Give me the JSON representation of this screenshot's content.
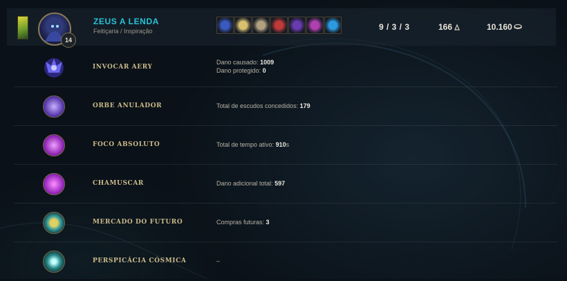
{
  "player": {
    "name": "ZEUS A LENDA",
    "rune_trees": "Feitiçaria / Inspiração",
    "level": "14",
    "kda": "9 / 3 / 3",
    "cs": "166",
    "gold": "10.160"
  },
  "items": [
    {
      "icon": "item-1-icon",
      "color": "#3a5ac0"
    },
    {
      "icon": "item-2-icon",
      "color": "#d8c070"
    },
    {
      "icon": "item-3-icon",
      "color": "#b0a080"
    },
    {
      "icon": "item-4-icon",
      "color": "#c03a3a"
    },
    {
      "icon": "item-5-icon",
      "color": "#6a3ab0"
    },
    {
      "icon": "item-6-icon",
      "color": "#b040b0"
    },
    {
      "icon": "item-7-icon",
      "color": "#2c9ae0"
    }
  ],
  "runes": [
    {
      "name": "INVOCAR AERY",
      "stats": [
        {
          "label": "Dano causado:",
          "value": "1009",
          "suffix": ""
        },
        {
          "label": "Dano protegido:",
          "value": "0",
          "suffix": ""
        }
      ],
      "color": "#5a5ae0"
    },
    {
      "name": "ORBE ANULADOR",
      "stats": [
        {
          "label": "Total de escudos concedidos:",
          "value": "179",
          "suffix": ""
        }
      ],
      "color": "#8a6ae0"
    },
    {
      "name": "FOCO ABSOLUTO",
      "stats": [
        {
          "label": "Total de tempo ativo:",
          "value": "910",
          "suffix": "s"
        }
      ],
      "color": "#b040c8"
    },
    {
      "name": "CHAMUSCAR",
      "stats": [
        {
          "label": "Dano adicional total:",
          "value": "597",
          "suffix": ""
        }
      ],
      "color": "#b03ad0"
    },
    {
      "name": "MERCADO DO FUTURO",
      "stats": [
        {
          "label": "Compras futuras:",
          "value": "3",
          "suffix": ""
        }
      ],
      "color": "#3aa0a0"
    },
    {
      "name": "PERSPICÁCIA CÓSMICA",
      "stats": [
        {
          "label": "–",
          "value": "",
          "suffix": ""
        }
      ],
      "color": "#3ab0b0"
    }
  ]
}
